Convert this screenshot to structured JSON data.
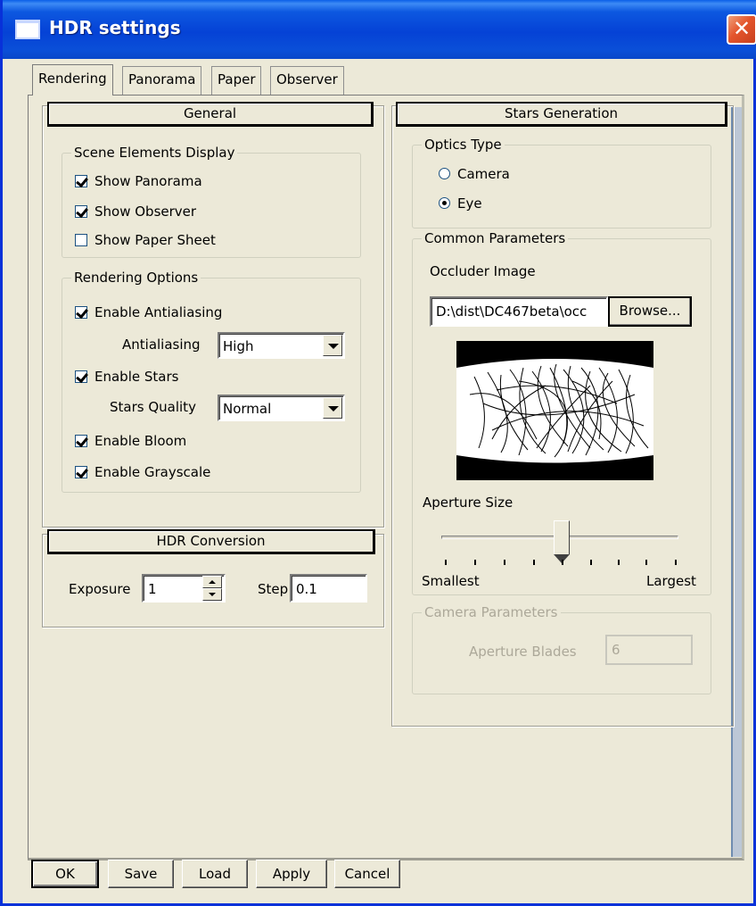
{
  "window": {
    "title": "HDR settings",
    "close_glyph": "✕"
  },
  "tabs": [
    {
      "label": "Rendering",
      "active": true
    },
    {
      "label": "Panorama",
      "active": false
    },
    {
      "label": "Paper",
      "active": false
    },
    {
      "label": "Observer",
      "active": false
    }
  ],
  "general": {
    "header": "General",
    "scene_elements": {
      "label": "Scene Elements Display",
      "items": [
        {
          "label": "Show Panorama",
          "checked": true
        },
        {
          "label": "Show Observer",
          "checked": true
        },
        {
          "label": "Show Paper Sheet",
          "checked": false
        }
      ]
    },
    "rendering_options": {
      "label": "Rendering Options",
      "enable_antialiasing": {
        "label": "Enable Antialiasing",
        "checked": true
      },
      "antialiasing": {
        "label": "Antialiasing",
        "value": "High"
      },
      "enable_stars": {
        "label": "Enable Stars",
        "checked": true
      },
      "stars_quality": {
        "label": "Stars Quality",
        "value": "Normal"
      },
      "enable_bloom": {
        "label": "Enable Bloom",
        "checked": true
      },
      "enable_grayscale": {
        "label": "Enable Grayscale",
        "checked": true
      }
    }
  },
  "hdr_conversion": {
    "header": "HDR Conversion",
    "exposure": {
      "label": "Exposure",
      "value": "1"
    },
    "step": {
      "label": "Step",
      "value": "0.1"
    }
  },
  "stars_generation": {
    "header": "Stars Generation",
    "optics_type": {
      "label": "Optics Type",
      "options": [
        {
          "label": "Camera",
          "selected": false
        },
        {
          "label": "Eye",
          "selected": true
        }
      ]
    },
    "common_parameters": {
      "label": "Common Parameters",
      "occluder_label": "Occluder Image",
      "occluder_path": "D:\\dist\\DC467beta\\occ",
      "browse_label": "Browse...",
      "aperture_label": "Aperture Size",
      "aperture_level_fraction": 0.5,
      "smallest_label": "Smallest",
      "largest_label": "Largest"
    },
    "camera_parameters": {
      "label": "Camera Parameters",
      "aperture_blades_label": "Aperture Blades",
      "aperture_blades_value": "6",
      "enabled": false
    }
  },
  "buttons": {
    "ok": "OK",
    "save": "Save",
    "load": "Load",
    "apply": "Apply",
    "cancel": "Cancel"
  },
  "colors": {
    "titlebar": "#0542d6",
    "face": "#ece9d8",
    "close": "#e4552c"
  }
}
